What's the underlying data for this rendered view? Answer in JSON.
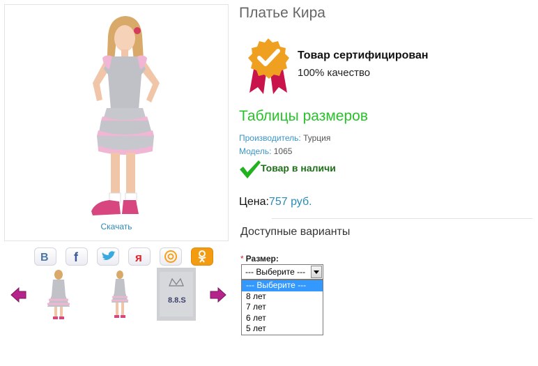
{
  "product": {
    "title": "Платье Кира",
    "download_label": "Скачать"
  },
  "certificate": {
    "title": "Товар сертифицирован",
    "subtitle": "100% качество"
  },
  "size_table_link": "Таблицы размеров",
  "specs": {
    "maker_label": "Производитель:",
    "maker_value": "Турция",
    "model_label": "Модель:",
    "model_value": "1065"
  },
  "stock": {
    "text": "Товар в наличи"
  },
  "price": {
    "label": "Цена:",
    "value": "757 руб."
  },
  "options": {
    "title": "Доступные варианты",
    "required_mark": "*",
    "size_label": "Размер:",
    "selected": "--- Выберите ---",
    "items": [
      "--- Выберите ---",
      "8 лет",
      "7 лет",
      "6 лет",
      "5 лет"
    ]
  },
  "share_icons": [
    "vk-icon",
    "facebook-icon",
    "twitter-icon",
    "moimir-icon",
    "mailru-icon",
    "odnoklassniki-icon"
  ],
  "colors": {
    "accent_blue": "#2a8ab8",
    "size_link_green": "#29c22b",
    "stock_green": "#1f6f1a",
    "arrow_magenta": "#b5248b",
    "badge_gold": "#f0a020",
    "ribbon": "#c8144a"
  }
}
